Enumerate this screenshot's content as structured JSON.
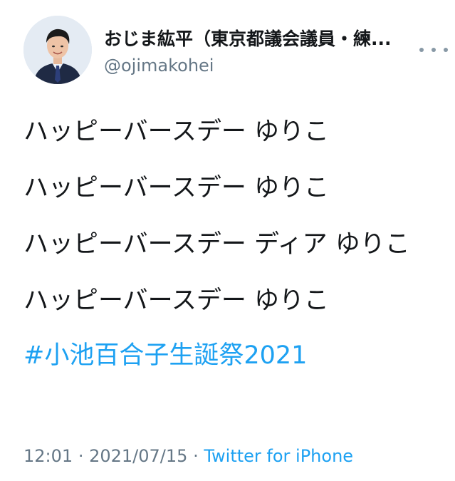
{
  "author": {
    "display_name": "おじま紘平（東京都議会議員・練...",
    "handle": "@ojimakohei",
    "avatar_icon": "profile-photo-icon"
  },
  "more_icon": "more-options-icon",
  "tweet": {
    "lines": [
      "ハッピーバースデー ゆりこ",
      "ハッピーバースデー ゆりこ",
      "ハッピーバースデー ディア ゆりこ",
      "ハッピーバースデー ゆりこ"
    ],
    "hashtag": "#小池百合子生誕祭2021"
  },
  "meta": {
    "time": "12:01",
    "separator": "·",
    "date": "2021/07/15",
    "source": "Twitter for iPhone"
  },
  "colors": {
    "text": "#14171a",
    "secondary": "#657786",
    "link": "#1da1f2"
  }
}
